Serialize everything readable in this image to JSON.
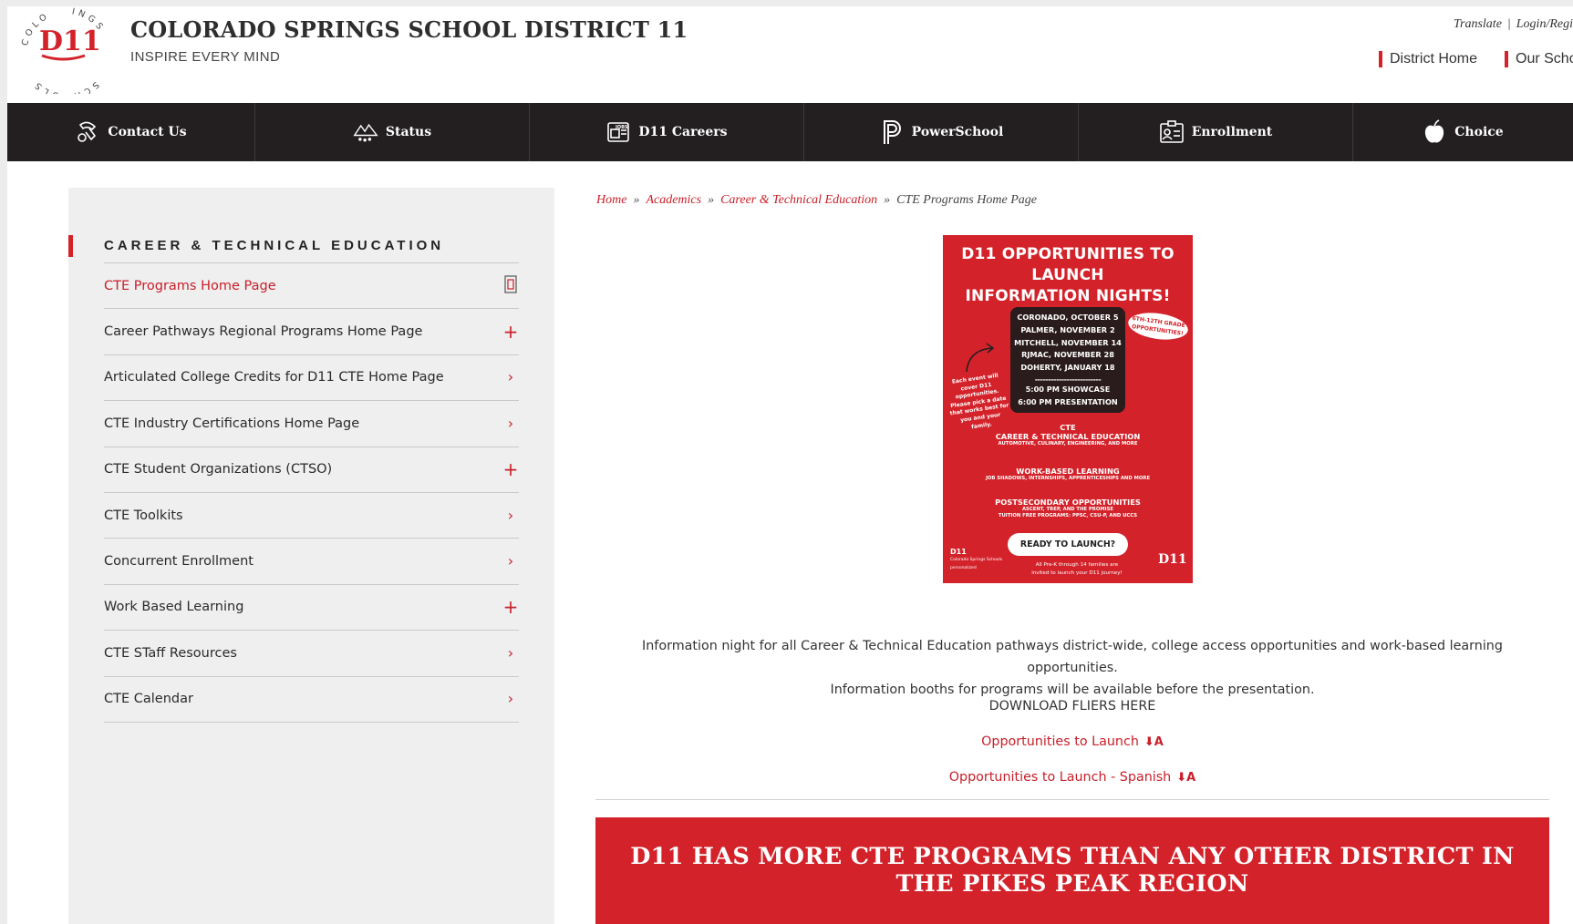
{
  "header": {
    "logo_mark": "D11",
    "logo_ring_text": "COLORADO SPRINGS SCHOOLS",
    "site_title": "COLORADO SPRINGS SCHOOL DISTRICT 11",
    "tagline": "INSPIRE EVERY MIND",
    "utility": {
      "translate": "Translate",
      "separator": "|",
      "login": "Login/Regi"
    },
    "top_links": [
      "District Home",
      "Our Scho"
    ],
    "accent_color": "#d3222a"
  },
  "main_nav": [
    {
      "label": "Contact Us",
      "icon": "contact-icon"
    },
    {
      "label": "Status",
      "icon": "weather-status-icon"
    },
    {
      "label": "D11 Careers",
      "icon": "jobs-icon"
    },
    {
      "label": "PowerSchool",
      "icon": "powerschool-icon"
    },
    {
      "label": "Enrollment",
      "icon": "id-card-icon"
    },
    {
      "label": "Choice",
      "icon": "apple-icon"
    }
  ],
  "sidebar": {
    "title": "CAREER & TECHNICAL EDUCATION",
    "items": [
      {
        "label": "CTE Programs Home Page",
        "marker": "▯",
        "active": true
      },
      {
        "label": "Career Pathways Regional Programs Home Page",
        "marker": "+"
      },
      {
        "label": "Articulated College Credits for D11 CTE Home Page",
        "marker": "›"
      },
      {
        "label": "CTE Industry Certifications Home Page",
        "marker": "›"
      },
      {
        "label": "CTE Student Organizations (CTSO)",
        "marker": "+"
      },
      {
        "label": "CTE Toolkits",
        "marker": "›"
      },
      {
        "label": "Concurrent Enrollment",
        "marker": "›"
      },
      {
        "label": "Work Based Learning",
        "marker": "+"
      },
      {
        "label": "CTE STaff Resources",
        "marker": "›"
      },
      {
        "label": "CTE Calendar",
        "marker": "›"
      }
    ]
  },
  "breadcrumb": {
    "items": [
      "Home",
      "Academics",
      "Career & Technical Education"
    ],
    "current": "CTE Programs Home Page",
    "separator": "»"
  },
  "flyer": {
    "headline_1": "D11 OPPORTUNITIES TO LAUNCH",
    "headline_2": "INFORMATION NIGHTS!",
    "dates": [
      "CORONADO, OCTOBER 5",
      "PALMER, NOVEMBER 2",
      "MITCHELL, NOVEMBER 14",
      "RJMAC, NOVEMBER 28",
      "DOHERTY, JANUARY 18"
    ],
    "divider": "-------------------------",
    "times": [
      "5:00 PM SHOWCASE",
      "6:00 PM PRESENTATION"
    ],
    "badge": "6TH-12TH GRADE OPPORTUNITIES!",
    "note": "Each event will cover D11 opportunities. Please pick a date that works best for you and your family.",
    "sections": [
      {
        "title": "CTE",
        "title2": "CAREER & TECHNICAL EDUCATION",
        "sub": "AUTOMOTIVE, CULINARY, ENGINEERING, AND MORE"
      },
      {
        "title": "WORK-BASED LEARNING",
        "sub": "JOB SHADOWS, INTERNSHIPS, APPRENTICESHIPS AND MORE"
      },
      {
        "title": "POSTSECONDARY OPPORTUNITIES",
        "sub": "ASCENT, TREP, AND THE PROMISE",
        "sub2": "TUITION FREE PROGRAMS: PPSC, CSU-P, AND UCCS"
      }
    ],
    "button": "READY TO LAUNCH?",
    "footer": "All Pre-K through 14 families are invited to launch your D11 journey!",
    "logo_left": "D11",
    "logo_left_small": "Colorado Springs Schools",
    "logo_left_tag": "personalized",
    "logo_right": "D11"
  },
  "content": {
    "description_line1": "Information night for all Career & Technical Education pathways district-wide, college access opportunities and work-based learning opportunities.",
    "description_line2": "Information booths for programs will be available before the presentation.",
    "downloads_title": "DOWNLOAD FLIERS HERE",
    "downloads": [
      {
        "label": "Opportunities to Launch",
        "icon": "pdf-icon"
      },
      {
        "label": "Opportunities to Launch - Spanish",
        "icon": "pdf-icon"
      }
    ],
    "banner": "D11 HAS MORE CTE PROGRAMS THAN ANY OTHER DISTRICT IN THE PIKES PEAK REGION"
  }
}
